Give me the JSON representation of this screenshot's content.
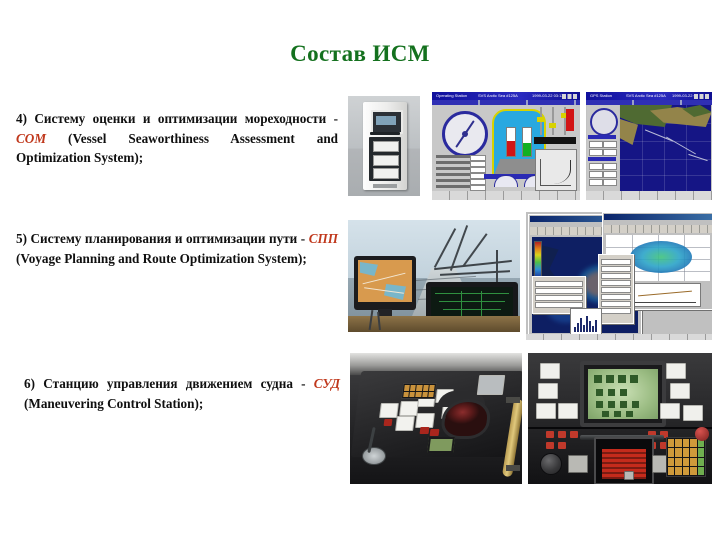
{
  "slide": {
    "title": "Состав ИСМ",
    "title_color": "#14711e",
    "accent_color": "#c0381c",
    "background": "#ffffff"
  },
  "paragraphs": [
    {
      "number": "4)",
      "lead": "Систему оценки и оптимизации мореходности - ",
      "abbr": "СОМ",
      "expansion": " (Vessel Seaworthiness Assessment and Optimization System);",
      "full_text": "4) Систему оценки и оптимизации мореходности - СОМ (Vessel Seaworthiness Assessment and Optimization System);"
    },
    {
      "number": "5)",
      "lead": "Систему планирования и оптимизации пути - ",
      "abbr": "СПП",
      "expansion": " (Voyage Planning and Route Optimization System);",
      "full_text": "5) Систему планирования и оптимизации пути - СПП (Voyage Planning and Route Optimization System);"
    },
    {
      "number": "6)",
      "lead": "Станцию управления движением судна - ",
      "abbr": "СУД",
      "expansion": " (Maneuvering Control Station);",
      "full_text": "6) Станцию управления движением судна - СУД (Maneuvering Control Station);"
    }
  ],
  "figures": {
    "row1": {
      "caption_group": "СОМ",
      "panels": [
        {
          "name": "equipment-cabinet-photo",
          "kind": "photo",
          "subject": "Шкаф вычислительного комплекса"
        },
        {
          "name": "operating-station-screen",
          "kind": "screenshot",
          "window_title": "Operating Station",
          "vessel_field": "SVS Arctic Sea #125A",
          "timestamp": "1999-03-22  03:11:16"
        },
        {
          "name": "gps-chart-screen",
          "kind": "screenshot",
          "window_title": "GPS Station",
          "vessel_field": "SVS Arctic Sea #125A",
          "timestamp": "1999-03-22  03:30:54"
        }
      ]
    },
    "row2": {
      "caption_group": "СПП",
      "panels": [
        {
          "name": "bridge-ecdis-photo",
          "kind": "photo",
          "subject": "Ходовой мостик с ЭКНИС"
        },
        {
          "name": "wave-analysis-software",
          "kind": "screenshot",
          "subject": "Анализ волнения и метеоданных"
        }
      ]
    },
    "row3": {
      "caption_group": "СУД",
      "panels": [
        {
          "name": "bridge-console-photo",
          "kind": "photo",
          "subject": "Пульт управления на мостике"
        },
        {
          "name": "maneuvering-control-panel-photo",
          "kind": "photo",
          "subject": "Панель станции управления движением"
        }
      ]
    }
  }
}
